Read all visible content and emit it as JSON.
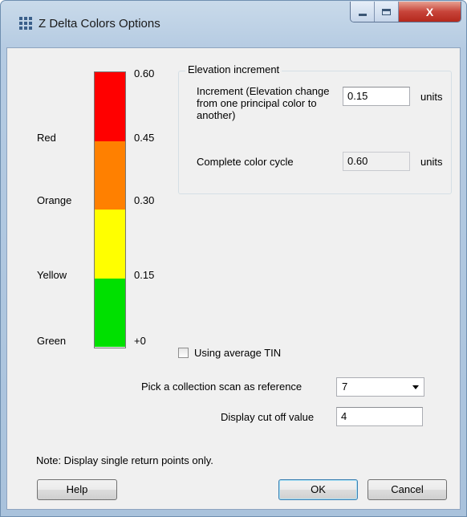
{
  "window": {
    "title": "Z Delta Colors Options",
    "close_glyph": "X"
  },
  "color_bar": {
    "segments": [
      {
        "color": "#ff0000",
        "label": "Red"
      },
      {
        "color": "#ff8000",
        "label": "Orange"
      },
      {
        "color": "#ffff00",
        "label": "Yellow"
      },
      {
        "color": "#00e000",
        "label": "Green"
      }
    ],
    "ticks": [
      "0.60",
      "0.45",
      "0.30",
      "0.15",
      "+0"
    ]
  },
  "elevation": {
    "legend": "Elevation increment",
    "increment_label": "Increment (Elevation change from one principal color to another)",
    "increment_value": "0.15",
    "increment_units": "units",
    "cycle_label": "Complete color cycle",
    "cycle_value": "0.60",
    "cycle_units": "units"
  },
  "tin": {
    "label": "Using average TIN",
    "checked": false
  },
  "reference": {
    "label": "Pick a collection scan as reference",
    "value": "7"
  },
  "cutoff": {
    "label": "Display cut off value",
    "value": "4"
  },
  "note": "Note: Display single return points only.",
  "buttons": {
    "help": "Help",
    "ok": "OK",
    "cancel": "Cancel"
  }
}
